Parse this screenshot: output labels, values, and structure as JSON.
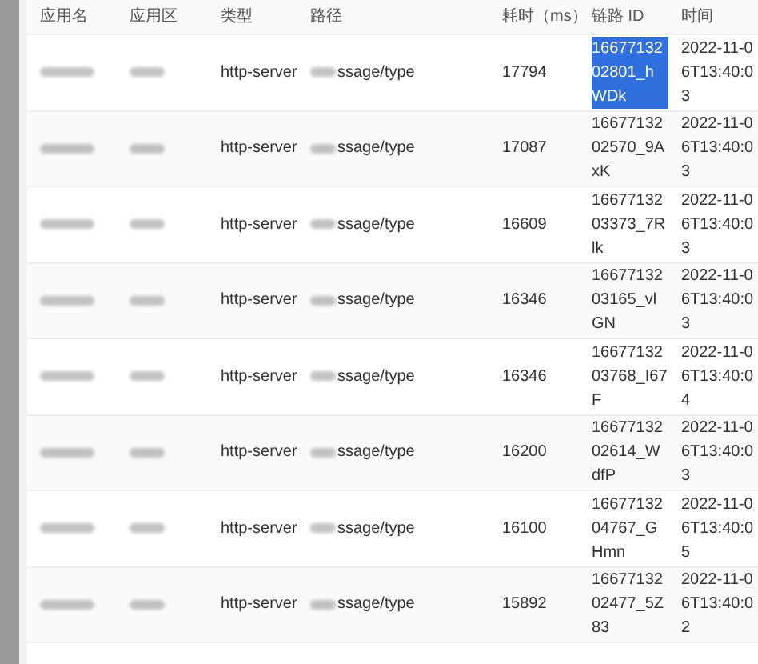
{
  "table": {
    "columns": [
      "应用名",
      "应用区",
      "类型",
      "路径",
      "耗时（ms）",
      "链路 ID",
      "时间"
    ],
    "rows": [
      {
        "type": "http-server",
        "path": "ssage/type",
        "duration": "17794",
        "trace_id": "1667713202801_hWDk",
        "time": "2022-11-06T13:40:03",
        "trace_selected": true
      },
      {
        "type": "http-server",
        "path": "ssage/type",
        "duration": "17087",
        "trace_id": "1667713202570_9AxK",
        "time": "2022-11-06T13:40:03",
        "trace_selected": false
      },
      {
        "type": "http-server",
        "path": "ssage/type",
        "duration": "16609",
        "trace_id": "1667713203373_7Rlk",
        "time": "2022-11-06T13:40:03",
        "trace_selected": false
      },
      {
        "type": "http-server",
        "path": "ssage/type",
        "duration": "16346",
        "trace_id": "1667713203165_vlGN",
        "time": "2022-11-06T13:40:03",
        "trace_selected": false
      },
      {
        "type": "http-server",
        "path": "ssage/type",
        "duration": "16346",
        "trace_id": "1667713203768_I67F",
        "time": "2022-11-06T13:40:04",
        "trace_selected": false
      },
      {
        "type": "http-server",
        "path": "ssage/type",
        "duration": "16200",
        "trace_id": "1667713202614_WdfP",
        "time": "2022-11-06T13:40:03",
        "trace_selected": false
      },
      {
        "type": "http-server",
        "path": "ssage/type",
        "duration": "16100",
        "trace_id": "1667713204767_GHmn",
        "time": "2022-11-06T13:40:05",
        "trace_selected": false
      },
      {
        "type": "http-server",
        "path": "ssage/type",
        "duration": "15892",
        "trace_id": "1667713202477_5Z83",
        "time": "2022-11-06T13:40:02",
        "trace_selected": false
      }
    ]
  }
}
